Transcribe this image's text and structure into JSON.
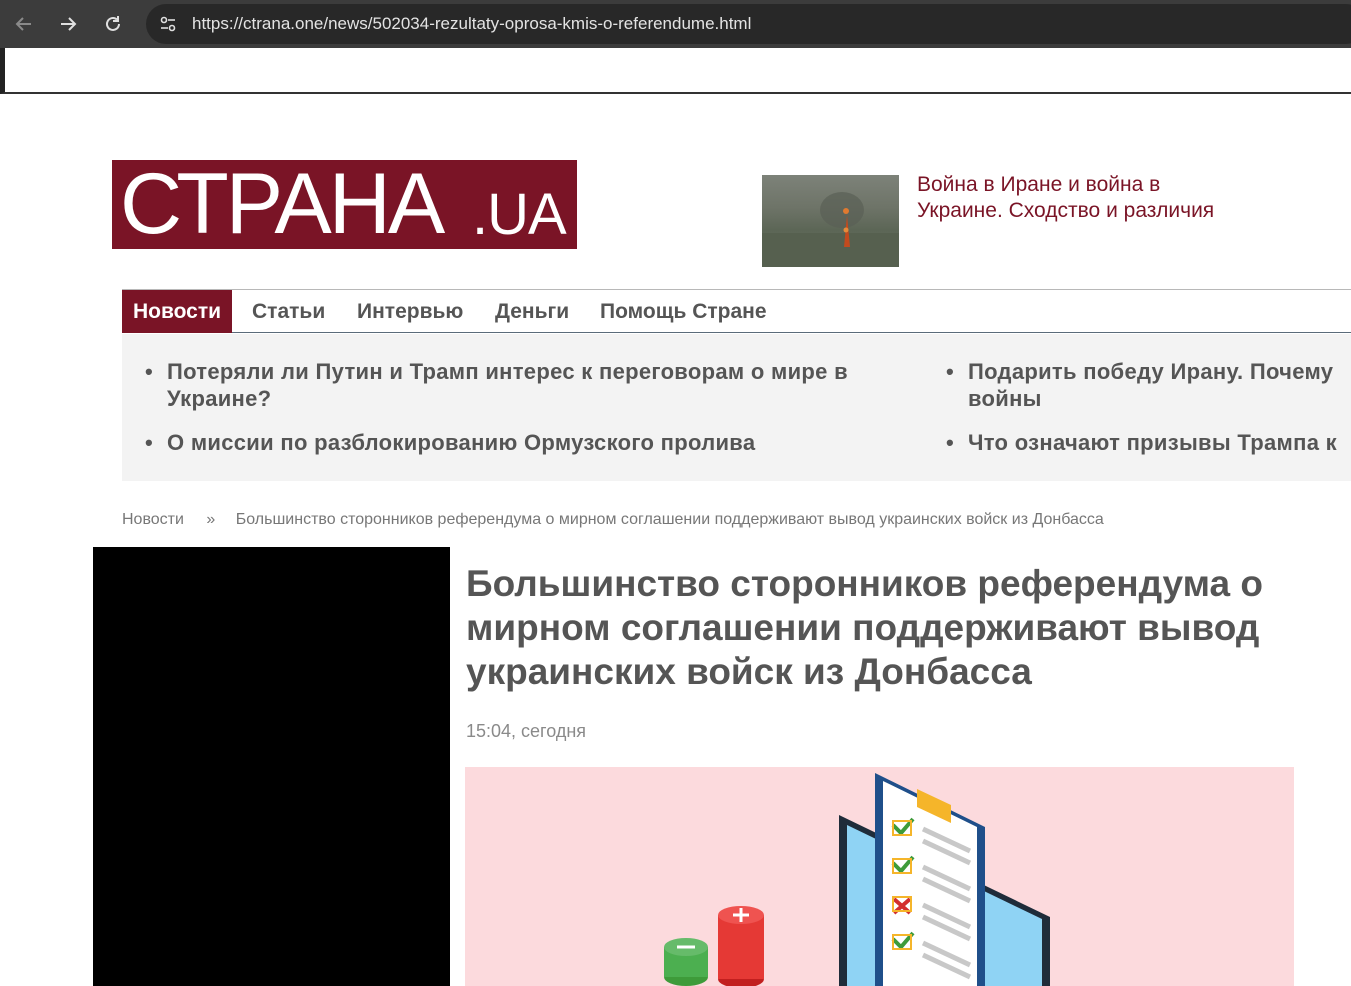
{
  "browser": {
    "back_icon": "arrow-left-icon",
    "forward_icon": "arrow-right-icon",
    "reload_icon": "reload-icon",
    "site_info_icon": "tune-icon",
    "url": "https://ctrana.one/news/502034-rezultaty-oprosa-kmis-o-referendume.html"
  },
  "site": {
    "logo_main": "СТРАНА",
    "logo_suffix": ".UA",
    "brand_color": "#7a1426",
    "promo": {
      "title": "Война в Иране и война в Украине. Сходство и различия"
    }
  },
  "nav": {
    "items": [
      {
        "label": "Новости",
        "active": true
      },
      {
        "label": "Статьи"
      },
      {
        "label": "Интервью"
      },
      {
        "label": "Деньги"
      },
      {
        "label": "Помощь Стране"
      }
    ]
  },
  "hot_news": [
    "Потеряли ли Путин и Трамп интерес к переговорам о мире в Украине?",
    "О миссии по разблокированию Ормузского пролива",
    "Подарить победу Ирану. Почему войны",
    "Что означают призывы Трампа к"
  ],
  "breadcrumb": {
    "root": "Новости",
    "separator": "»",
    "current": "Большинство сторонников референдума о мирном соглашении поддерживают вывод украинских войск из Донбасса"
  },
  "article": {
    "title": "Большинство сторонников референдума о мирном соглашении поддерживают вывод украинских войск из Донбасса",
    "time": "15:04, сегодня"
  }
}
